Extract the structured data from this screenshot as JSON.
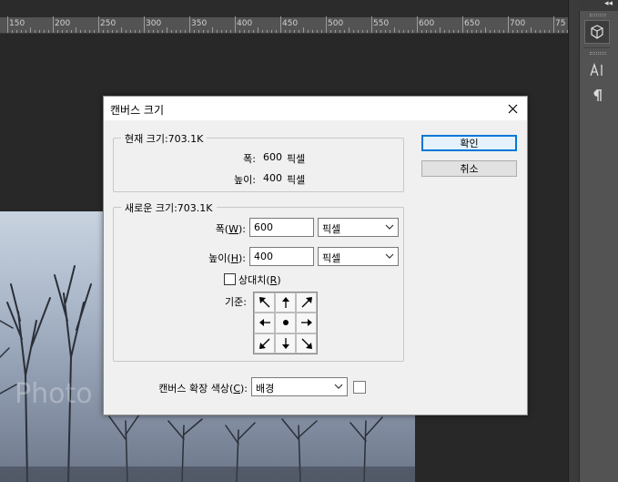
{
  "ruler": {
    "labels": [
      "150",
      "200",
      "250",
      "300",
      "350",
      "400",
      "450",
      "500",
      "550",
      "600",
      "650",
      "700",
      "75"
    ]
  },
  "photo": {
    "watermark": "Photo"
  },
  "panel": {
    "collapse_label": "◂◂"
  },
  "dialog": {
    "title": "캔버스 크기",
    "current_size": {
      "legend": "현재 크기:703.1K",
      "width_label": "폭:",
      "width_value": "600",
      "width_unit": "픽셀",
      "height_label": "높이:",
      "height_value": "400",
      "height_unit": "픽셀"
    },
    "new_size": {
      "legend": "새로운 크기:703.1K",
      "width_label_pre": "폭(",
      "width_hotkey": "W",
      "width_label_post": "):",
      "width_value": "600",
      "width_unit": "픽셀",
      "height_label_pre": "높이(",
      "height_hotkey": "H",
      "height_label_post": "):",
      "height_value": "400",
      "height_unit": "픽셀",
      "relative_pre": "상대치(",
      "relative_hotkey": "R",
      "relative_post": ")",
      "relative_checked": false,
      "anchor_label": "기준:"
    },
    "extension_color": {
      "label_pre": "캔버스 확장 색상(",
      "label_hotkey": "C",
      "label_post": "):",
      "value": "배경",
      "swatch_color": "#ffffff"
    },
    "ok_label": "확인",
    "cancel_label": "취소"
  }
}
